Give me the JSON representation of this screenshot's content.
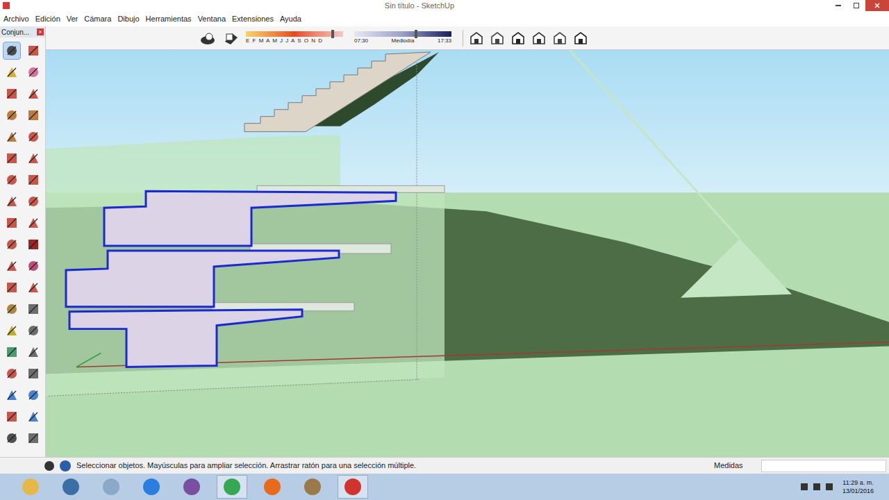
{
  "window": {
    "title": "Sin título - SketchUp"
  },
  "menu": [
    "Archivo",
    "Edición",
    "Ver",
    "Cámara",
    "Dibujo",
    "Herramientas",
    "Ventana",
    "Extensiones",
    "Ayuda"
  ],
  "shadow_toolbar": {
    "months": "E F M A M J J A S O N D",
    "month_level": 0.88,
    "time_start": "07:30",
    "time_mid": "Mediodía",
    "time_end": "17:33",
    "time_level": 0.62
  },
  "tool_panel": {
    "title": "Conjun..."
  },
  "tools": [
    {
      "selected": true
    },
    {
      "selected": false
    },
    {
      "selected": false
    },
    {
      "selected": false
    },
    {
      "selected": false
    },
    {
      "selected": false
    },
    {
      "selected": false
    },
    {
      "selected": false
    },
    {
      "selected": false
    },
    {
      "selected": false
    },
    {
      "selected": false
    },
    {
      "selected": false
    },
    {
      "selected": false
    },
    {
      "selected": false
    },
    {
      "selected": false
    },
    {
      "selected": false
    },
    {
      "selected": false
    },
    {
      "selected": false
    },
    {
      "selected": false
    },
    {
      "selected": false
    },
    {
      "selected": false
    },
    {
      "selected": false
    },
    {
      "selected": false
    },
    {
      "selected": false
    },
    {
      "selected": false
    },
    {
      "selected": false
    },
    {
      "selected": false
    },
    {
      "selected": false
    },
    {
      "selected": false
    },
    {
      "selected": false
    },
    {
      "selected": false
    },
    {
      "selected": false
    },
    {
      "selected": false
    },
    {
      "selected": false
    },
    {
      "selected": false
    },
    {
      "selected": false
    },
    {
      "selected": false
    },
    {
      "selected": false
    }
  ],
  "status_bar": {
    "message": "Seleccionar objetos. Mayúsculas para ampliar selección. Arrastrar ratón para una selección múltiple.",
    "measure_label": "Medidas"
  },
  "taskbar": {
    "time": "11:29 a. m.",
    "date": "13/01/2016"
  }
}
